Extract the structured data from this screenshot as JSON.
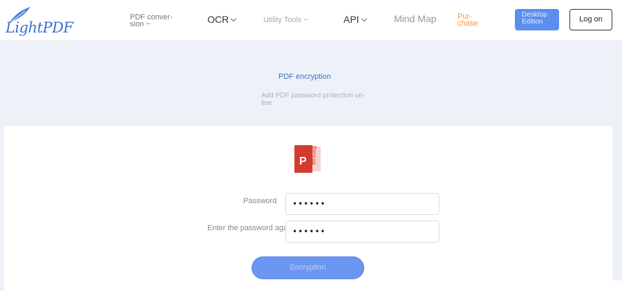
{
  "header": {
    "logo": {
      "text": "LightPDF",
      "icon": "feather-icon"
    },
    "nav": {
      "pdf_conversion": "PDF conver-sion ~",
      "ocr": "OCR",
      "utility_tools": "Utility Tools ~",
      "api": "API",
      "mind_map": "Mind Map",
      "purchase": "Pur-chase"
    },
    "desktop_button": "Desktop Edition",
    "login_button": "Log on"
  },
  "hero": {
    "title": "PDF encryption",
    "subtitle": "Add PDF password protection on-line"
  },
  "form": {
    "file_icon": "pdf-file-icon",
    "file_icon_label": "Вепсод",
    "password_label": "Password",
    "password_value": "••••••",
    "confirm_label": "Enter the password again:",
    "confirm_value": "••••••",
    "submit_label": "Encryption"
  },
  "colors": {
    "brand_blue": "#3b6fd6",
    "desktop_button": "#5b8ef0",
    "encrypt_button": "#6b96f2",
    "purchase": "#f0954a",
    "pdf_red": "#d23b2e",
    "page_bg": "#eef2f8"
  }
}
